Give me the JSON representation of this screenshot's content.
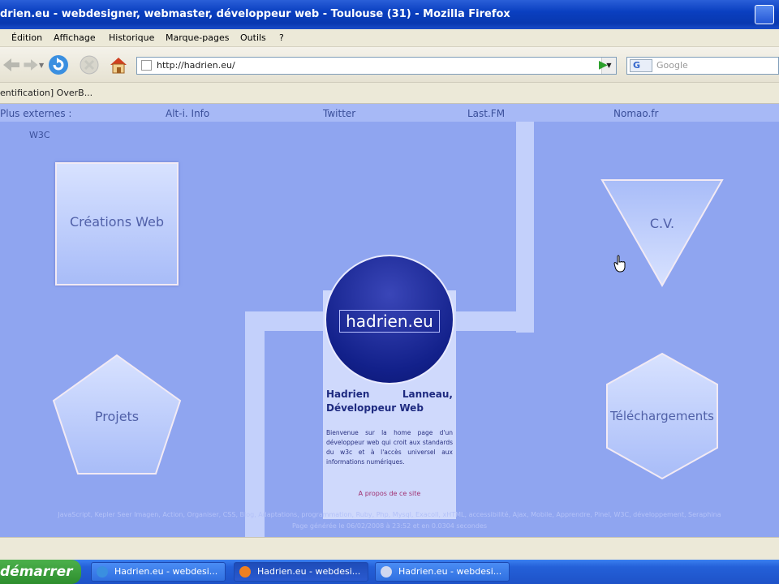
{
  "window": {
    "title": "drien.eu - webdesigner, webmaster, développeur web - Toulouse (31) - Mozilla Firefox"
  },
  "menu": [
    "Édition",
    "Affichage",
    "Historique",
    "Marque-pages",
    "Outils",
    "?"
  ],
  "toolbar": {
    "url": "http://hadrien.eu/",
    "search_placeholder": "Google",
    "search_engine": "G"
  },
  "bookmarks": {
    "item": "entification] OverB..."
  },
  "page": {
    "top_links": [
      "Plus externes :",
      "Alt-i. Info",
      "Twitter",
      "Last.FM",
      "Nomao.fr"
    ],
    "w3c": "W3C",
    "nav": {
      "creations": "Créations Web",
      "cv": "C.V.",
      "projets": "Projets",
      "telechargements": "Téléchargements"
    },
    "logo": "hadrien.eu",
    "card": {
      "title": "Hadrien Lanneau, Développeur Web",
      "text": "Bienvenue sur la home page d'un développeur web qui croit aux standards du w3c et à l'accès universel aux informations numériques.",
      "link": "A propos de ce site"
    },
    "footer_line1": "JavaScript, Kepler Seer Imagen, Action, Organiser, CSS, Blog, Adaptations, programmation, Ruby, Php, Mysql, Exacoll, xHTML, accessibilité, Ajax, Mobile, Apprendre, Pinel, W3C, développement, Seraphina",
    "footer_line2": "Page générée le 06/02/2008 à 23:52 et en 0.0304 secondes"
  },
  "taskbar": {
    "start": "démarrer",
    "tasks": [
      "Hadrien.eu - webdesi...",
      "Hadrien.eu - webdesi...",
      "Hadrien.eu - webdesi..."
    ]
  },
  "colors": {
    "page_bg": "#8fa5f0",
    "logo": "#12208a",
    "title_bar": "#0a3fc0"
  }
}
